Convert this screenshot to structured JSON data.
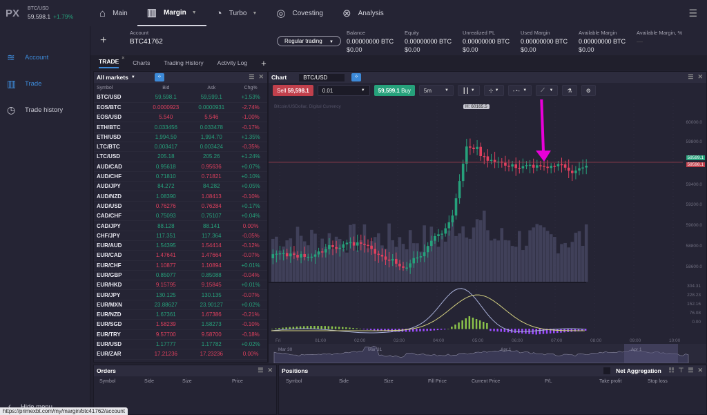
{
  "topbar": {
    "logo": "PX",
    "ticker_symbol": "BTC/USD",
    "ticker_price": "59,598.1",
    "ticker_change": "+1.79%",
    "nav": [
      {
        "label": "Main",
        "icon": "home-icon"
      },
      {
        "label": "Margin",
        "icon": "bar-chart-icon",
        "active": true,
        "dropdown": true
      },
      {
        "label": "Turbo",
        "icon": "turbo-icon",
        "dropdown": true
      },
      {
        "label": "Covesting",
        "icon": "covesting-icon"
      },
      {
        "label": "Analysis",
        "icon": "analysis-icon"
      }
    ]
  },
  "sidebar": {
    "items": [
      {
        "label": "Account",
        "icon": "layers-icon",
        "selected": true
      },
      {
        "label": "Trade",
        "icon": "bar-chart-icon",
        "selected": true
      },
      {
        "label": "Trade history",
        "icon": "clock-icon"
      }
    ],
    "hide_menu": "Hide menu"
  },
  "url_status": "https://primexbt.com/my/margin/btc41762/account",
  "account": {
    "label": "Account",
    "id": "BTC41762",
    "mode": "Regular trading",
    "stats": [
      {
        "label": "Balance",
        "btc": "0.00000000 BTC",
        "usd": "$0.00"
      },
      {
        "label": "Equity",
        "btc": "0.00000000 BTC",
        "usd": "$0.00"
      },
      {
        "label": "Unrealized PL",
        "btc": "0.00000000 BTC",
        "usd": "$0.00"
      },
      {
        "label": "Used Margin",
        "btc": "0.00000000 BTC",
        "usd": "$0.00"
      },
      {
        "label": "Available Margin",
        "btc": "0.00000000 BTC",
        "usd": "$0.00"
      },
      {
        "label": "Available Margin, %",
        "btc": "—",
        "usd": ""
      }
    ]
  },
  "tabs": [
    "TRADE",
    "Charts",
    "Trading History",
    "Activity Log"
  ],
  "markets": {
    "title": "All markets",
    "columns": [
      "Symbol",
      "Bid",
      "Ask",
      "Chg%"
    ],
    "rows": [
      [
        "BTC/USD",
        "59,598.1",
        "g",
        "59,599.1",
        "g",
        "+1.53%",
        "g"
      ],
      [
        "EOS/BTC",
        "0.0000923",
        "r",
        "0.0000931",
        "g",
        "-2.74%",
        "r"
      ],
      [
        "EOS/USD",
        "5.540",
        "r",
        "5.546",
        "r",
        "-1.00%",
        "r"
      ],
      [
        "ETH/BTC",
        "0.033456",
        "g",
        "0.033478",
        "g",
        "-0.17%",
        "r"
      ],
      [
        "ETH/USD",
        "1,994.50",
        "g",
        "1,994.70",
        "g",
        "+1.35%",
        "g"
      ],
      [
        "LTC/BTC",
        "0.003417",
        "g",
        "0.003424",
        "g",
        "-0.35%",
        "r"
      ],
      [
        "LTC/USD",
        "205.18",
        "g",
        "205.26",
        "g",
        "+1.24%",
        "g"
      ],
      [
        "AUD/CAD",
        "0.95618",
        "g",
        "0.95636",
        "r",
        "+0.07%",
        "g"
      ],
      [
        "AUD/CHF",
        "0.71810",
        "g",
        "0.71821",
        "r",
        "+0.10%",
        "g"
      ],
      [
        "AUD/JPY",
        "84.272",
        "g",
        "84.282",
        "g",
        "+0.05%",
        "g"
      ],
      [
        "AUD/NZD",
        "1.08390",
        "g",
        "1.08413",
        "r",
        "-0.10%",
        "r"
      ],
      [
        "AUD/USD",
        "0.76276",
        "r",
        "0.76284",
        "r",
        "+0.17%",
        "g"
      ],
      [
        "CAD/CHF",
        "0.75093",
        "g",
        "0.75107",
        "g",
        "+0.04%",
        "g"
      ],
      [
        "CAD/JPY",
        "88.128",
        "g",
        "88.141",
        "g",
        "0.00%",
        "r"
      ],
      [
        "CHF/JPY",
        "117.351",
        "g",
        "117.364",
        "g",
        "-0.05%",
        "r"
      ],
      [
        "EUR/AUD",
        "1.54395",
        "g",
        "1.54414",
        "r",
        "-0.12%",
        "r"
      ],
      [
        "EUR/CAD",
        "1.47641",
        "r",
        "1.47664",
        "r",
        "-0.07%",
        "r"
      ],
      [
        "EUR/CHF",
        "1.10877",
        "r",
        "1.10894",
        "r",
        "+0.01%",
        "g"
      ],
      [
        "EUR/GBP",
        "0.85077",
        "g",
        "0.85088",
        "g",
        "-0.04%",
        "r"
      ],
      [
        "EUR/HKD",
        "9.15795",
        "r",
        "9.15845",
        "r",
        "+0.01%",
        "g"
      ],
      [
        "EUR/JPY",
        "130.125",
        "g",
        "130.135",
        "g",
        "-0.07%",
        "r"
      ],
      [
        "EUR/MXN",
        "23.88627",
        "g",
        "23.90127",
        "g",
        "+0.02%",
        "g"
      ],
      [
        "EUR/NZD",
        "1.67361",
        "g",
        "1.67386",
        "r",
        "-0.21%",
        "r"
      ],
      [
        "EUR/SGD",
        "1.58239",
        "r",
        "1.58273",
        "g",
        "-0.10%",
        "r"
      ],
      [
        "EUR/TRY",
        "9.57700",
        "r",
        "9.58700",
        "r",
        "-0.18%",
        "r"
      ],
      [
        "EUR/USD",
        "1.17777",
        "g",
        "1.17782",
        "g",
        "+0.02%",
        "g"
      ],
      [
        "EUR/ZAR",
        "17.21236",
        "r",
        "17.23236",
        "r",
        "0.00%",
        "r"
      ]
    ]
  },
  "chart": {
    "title": "Chart",
    "symbol": "BTC/USD",
    "sell_label": "Sell",
    "sell_price": "59,598.1",
    "quantity": "0.01",
    "buy_price": "59,599.1",
    "buy_label": "Buy",
    "interval": "5m",
    "description": "Bitcoin/USDollar, Digital Currency",
    "high_label": "H: 60165.5",
    "price_axis": [
      "60000.0",
      "59800.0",
      "59400.0",
      "59200.0",
      "59000.0",
      "58800.0",
      "58600.0"
    ],
    "ask_tag": "59599.1",
    "bid_tag": "59598.1",
    "macd_axis": [
      "304.31",
      "228.23",
      "152.16",
      "76.08",
      "0.00"
    ],
    "time_axis": [
      "Fri",
      "01:00",
      "02:00",
      "03:00",
      "04:00",
      "05:00",
      "06:00",
      "07:00",
      "08:00",
      "09:00",
      "10:00"
    ],
    "navigator_labels": [
      "Mar 30",
      "Mar 31",
      "Apr 1",
      "Apr 1"
    ]
  },
  "orders": {
    "title": "Orders",
    "columns": [
      "Symbol",
      "Side",
      "Size",
      "Price"
    ]
  },
  "positions": {
    "title": "Positions",
    "net_aggregation": "Net Aggregation",
    "columns": [
      "Symbol",
      "Side",
      "Size",
      "Fill Price",
      "Current Price",
      "P/L",
      "Take profit",
      "Stop loss"
    ]
  }
}
